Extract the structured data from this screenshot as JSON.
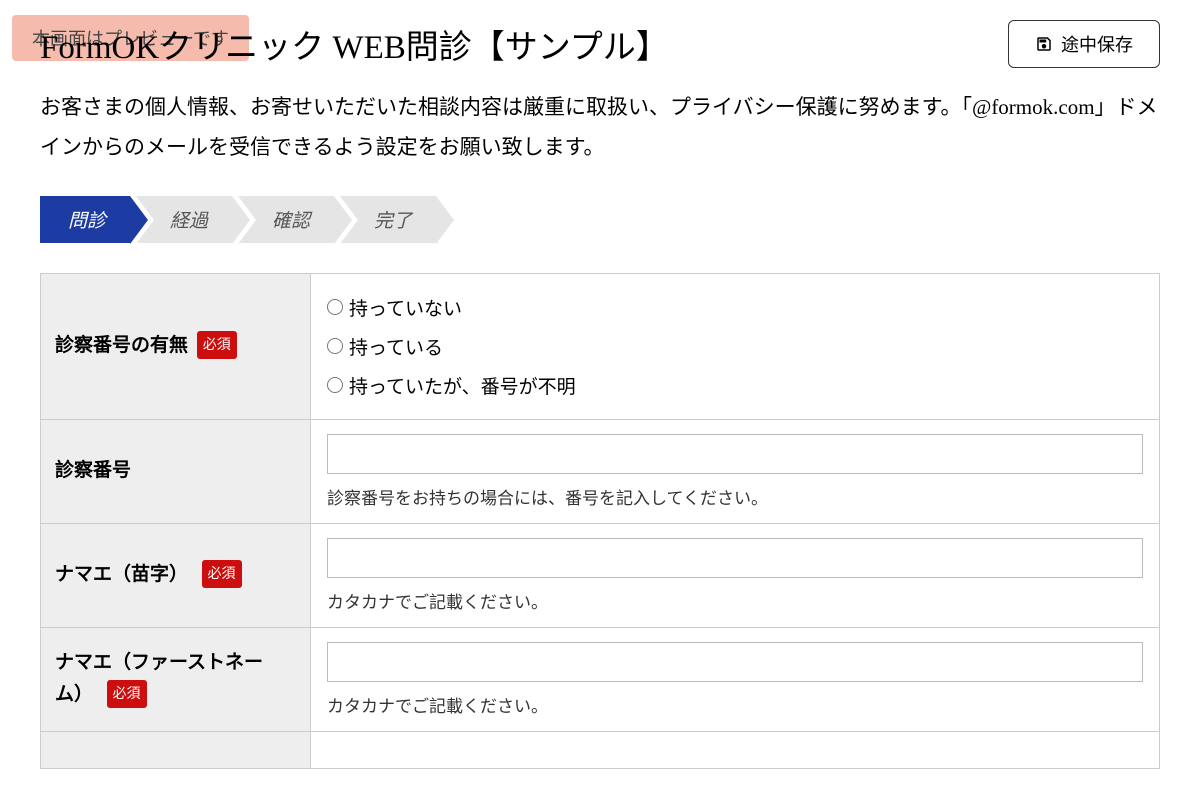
{
  "header": {
    "preview_badge": "本画面はプレビューです",
    "title": "FormOKクリニック WEB問診【サンプル】",
    "save_label": "途中保存"
  },
  "description": "お客さまの個人情報、お寄せいただいた相談内容は厳重に取扱い、プライバシー保護に努めます。「@formok.com」ドメインからのメールを受信できるよう設定をお願い致します。",
  "steps": [
    "問診",
    "経過",
    "確認",
    "完了"
  ],
  "required_label": "必須",
  "fields": {
    "exam_number_presence": {
      "label": "診察番号の有無",
      "required": true,
      "options": [
        "持っていない",
        "持っている",
        "持っていたが、番号が不明"
      ]
    },
    "exam_number": {
      "label": "診察番号",
      "required": false,
      "help": "診察番号をお持ちの場合には、番号を記入してください。"
    },
    "surname": {
      "label": "ナマエ（苗字）",
      "required": true,
      "help": "カタカナでご記載ください。"
    },
    "firstname": {
      "label": "ナマエ（ファーストネーム）",
      "required": true,
      "help": "カタカナでご記載ください。"
    }
  }
}
